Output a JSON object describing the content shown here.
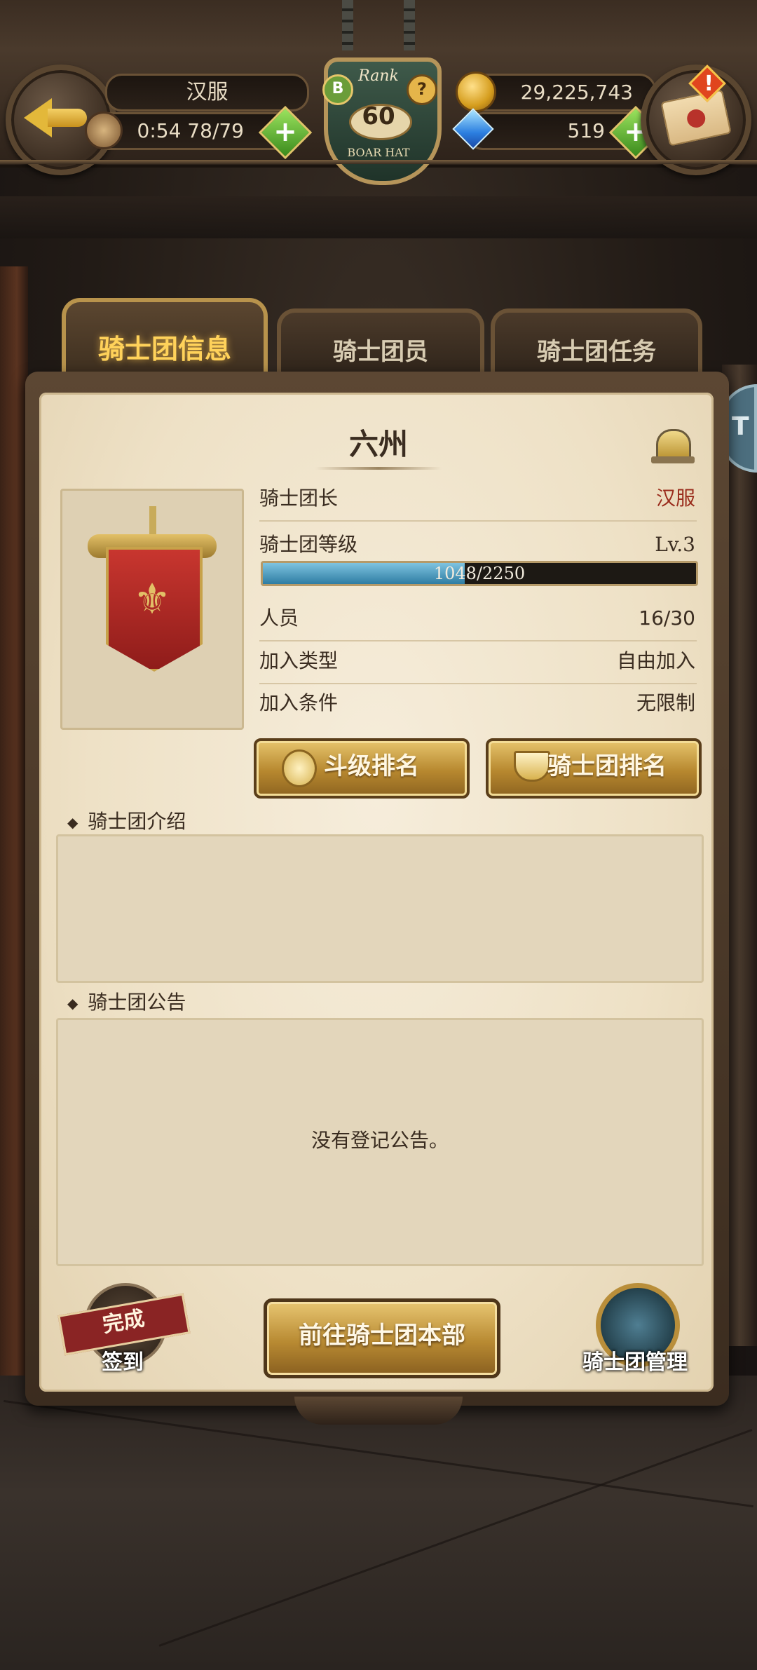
{
  "hud": {
    "player_name": "汉服",
    "stamina": "0:54 78/79",
    "gold": "29,225,743",
    "gems": "519",
    "rank_label": "Rank",
    "rank_value": "60",
    "rank_sub": "BOAR HAT",
    "rank_badge_letter": "B",
    "rank_help": "?",
    "mail_alert": "!"
  },
  "tabs": [
    {
      "label": "骑士团信息",
      "active": true
    },
    {
      "label": "骑士团员",
      "active": false
    },
    {
      "label": "骑士团任务",
      "active": false
    }
  ],
  "side_tab": {
    "label": "T"
  },
  "guild": {
    "name": "六州",
    "leader_label": "骑士团长",
    "leader_value": "汉服",
    "level_label": "骑士团等级",
    "level_value": "Lv.3",
    "xp_text": "1048/2250",
    "xp_fraction": 0.4658,
    "members_label": "人员",
    "members_value": "16/30",
    "join_type_label": "加入类型",
    "join_type_value": "自由加入",
    "join_cond_label": "加入条件",
    "join_cond_value": "无限制"
  },
  "buttons": {
    "rank_level": "斗级排名",
    "rank_guild": "骑士团排名",
    "go_hq": "前往骑士团本部",
    "checkin_status": "完成",
    "checkin": "签到",
    "manage": "骑士团管理"
  },
  "sections": {
    "intro_title": "骑士团介绍",
    "intro_text": "",
    "notice_title": "骑士团公告",
    "notice_text": "没有登记公告。"
  },
  "colors": {
    "accent_gold": "#ffd25a",
    "leader_red": "#9a2c1c",
    "xp_blue": "#2e7da3"
  }
}
